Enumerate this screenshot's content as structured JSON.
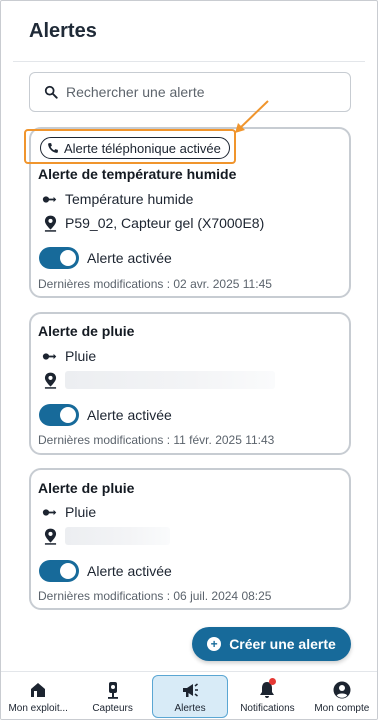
{
  "page": {
    "title": "Alertes"
  },
  "search": {
    "placeholder": "Rechercher une alerte"
  },
  "alerts": [
    {
      "badge": "Alerte téléphonique activée",
      "title": "Alerte de température humide",
      "type": "Température humide",
      "location": "P59_02,  Capteur gel (X7000E8)",
      "toggle_label": "Alerte activée",
      "enabled": true,
      "modified": "Dernières modifications : 02 avr. 2025 11:45"
    },
    {
      "title": "Alerte de pluie",
      "type": "Pluie",
      "toggle_label": "Alerte activée",
      "enabled": true,
      "modified": "Dernières modifications : 11 févr. 2025 11:43"
    },
    {
      "title": "Alerte de pluie",
      "type": "Pluie",
      "toggle_label": "Alerte activée",
      "enabled": true,
      "modified": "Dernières modifications : 06 juil. 2024 08:25"
    }
  ],
  "fab": {
    "label": "Créer une alerte"
  },
  "nav": {
    "items": [
      {
        "label": "Mon exploit...",
        "icon": "home-icon"
      },
      {
        "label": "Capteurs",
        "icon": "sensor-icon"
      },
      {
        "label": "Alertes",
        "icon": "megaphone-icon",
        "active": true
      },
      {
        "label": "Notifications",
        "icon": "bell-icon"
      },
      {
        "label": "Mon compte",
        "icon": "account-icon"
      }
    ]
  },
  "colors": {
    "accent": "#176a9a",
    "highlight": "#f0952d",
    "active_tab_bg": "#d8ebf7"
  }
}
